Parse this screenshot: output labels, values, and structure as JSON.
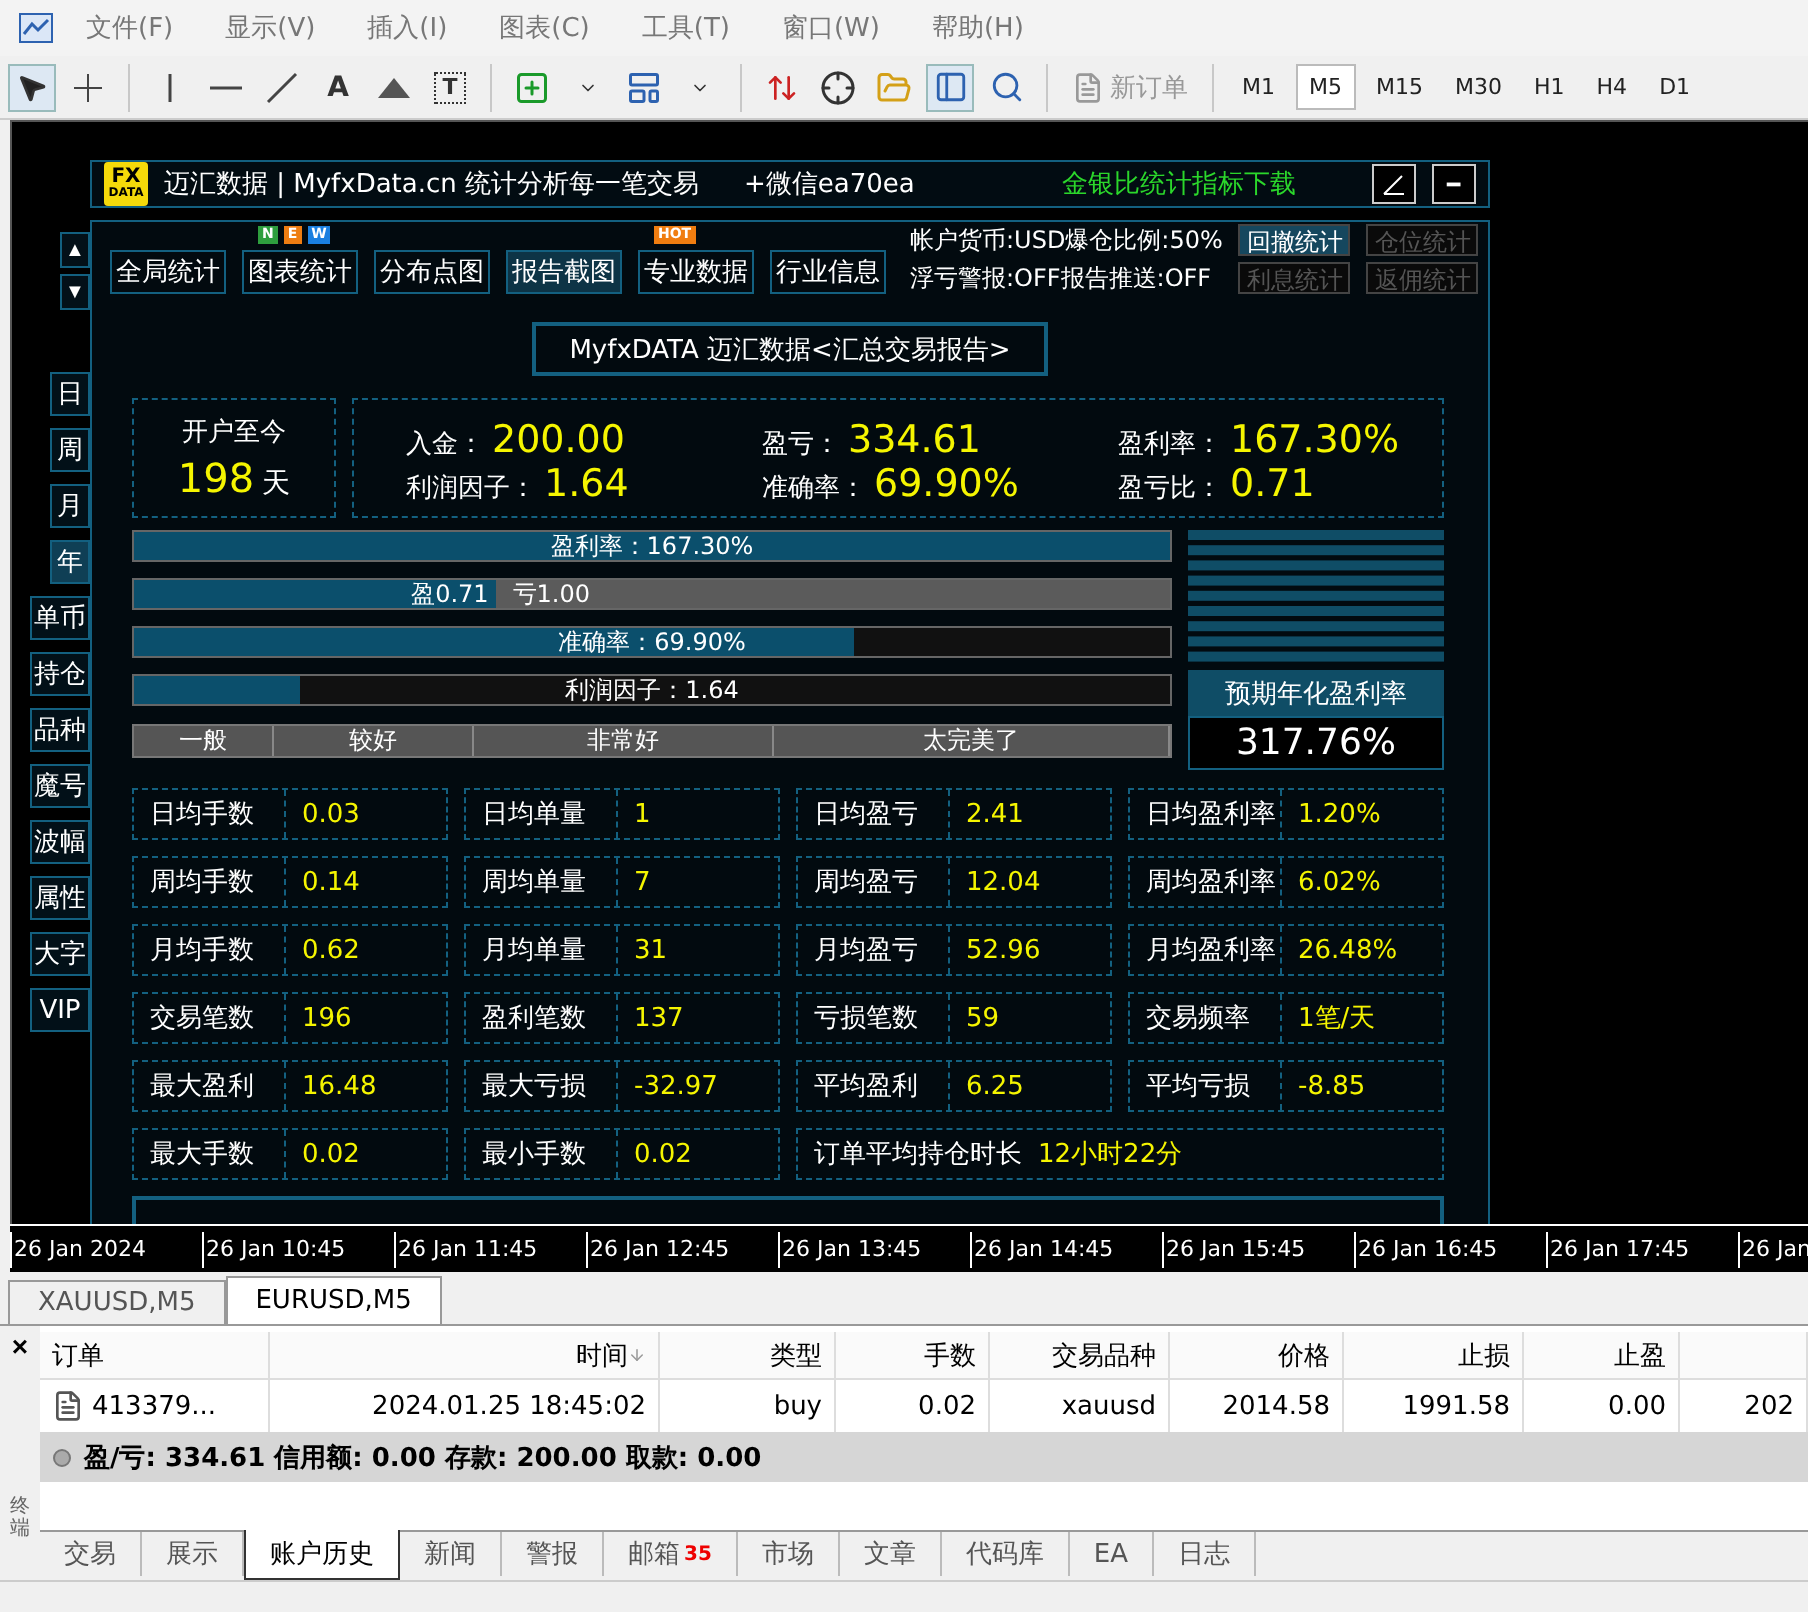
{
  "menu": [
    "文件(F)",
    "显示(V)",
    "插入(I)",
    "图表(C)",
    "工具(T)",
    "窗口(W)",
    "帮助(H)"
  ],
  "toolbar": {
    "text_tool": "A",
    "label_tool": "T",
    "new_order": {
      "label": "新订单",
      "disabled": true
    },
    "data_window_selected": true,
    "timeframes": [
      {
        "label": "M1",
        "selected": false
      },
      {
        "label": "M5",
        "selected": true
      },
      {
        "label": "M15",
        "selected": false
      },
      {
        "label": "M30",
        "selected": false
      },
      {
        "label": "H1",
        "selected": false
      },
      {
        "label": "H4",
        "selected": false
      },
      {
        "label": "D1",
        "selected": false
      }
    ]
  },
  "panel": {
    "logo_top": "FX",
    "logo_bottom": "DATA",
    "title": "迈汇数据 | MyfxData.cn  统计分析每一笔交易",
    "wechat": "+微信ea70ea",
    "download": "金银比统计指标下载",
    "minimize": "━",
    "scroll_up": "▲",
    "scroll_down": "▼",
    "periods": [
      {
        "label": "日",
        "selected": false
      },
      {
        "label": "周",
        "selected": false
      },
      {
        "label": "月",
        "selected": false
      },
      {
        "label": "年",
        "selected": true
      }
    ],
    "views": [
      "单币",
      "持仓",
      "品种",
      "魔号",
      "波幅",
      "属性",
      "大字",
      "VIP"
    ],
    "nav": [
      {
        "label": "全局统计",
        "selected": false
      },
      {
        "label": "图表统计",
        "selected": false,
        "badges": [
          {
            "text": "N",
            "color": "#2e9e3e"
          },
          {
            "text": "E",
            "color": "#ee7d12"
          },
          {
            "text": "W",
            "color": "#1a7fe0"
          }
        ]
      },
      {
        "label": "分布点图",
        "selected": false
      },
      {
        "label": "报告截图",
        "selected": true
      },
      {
        "label": "专业数据",
        "selected": false,
        "badges": [
          {
            "text": "HOT",
            "color": "#f07d10"
          }
        ]
      },
      {
        "label": "行业信息",
        "selected": false
      }
    ],
    "account_lines": [
      "帐户货币:USD爆仓比例:50%",
      "浮亏警报:OFF报告推送:OFF"
    ],
    "side_actions": [
      {
        "label": "回撤统计",
        "disabled": false
      },
      {
        "label": "仓位统计",
        "disabled": true
      },
      {
        "label": "利息统计",
        "disabled": true
      },
      {
        "label": "返佣统计",
        "disabled": true
      }
    ],
    "report_title": "MyfxDATA 迈汇数据<汇总交易报告>",
    "since": {
      "label": "开户至今",
      "value": "198",
      "unit": "天"
    },
    "metrics": [
      {
        "label": "入金：",
        "value": "200.00"
      },
      {
        "label": "盈亏：",
        "value": "334.61"
      },
      {
        "label": "盈利率：",
        "value": "167.30%"
      },
      {
        "label": "利润因子：",
        "value": "1.64"
      },
      {
        "label": "准确率：",
        "value": "69.90%"
      },
      {
        "label": "盈亏比：",
        "value": "0.71"
      }
    ],
    "bars": [
      {
        "kind": "single",
        "label": "盈利率：167.30%",
        "level": 1
      },
      {
        "kind": "split",
        "label": "盈0.71",
        "rest": "亏1.00",
        "level": 0.35
      },
      {
        "kind": "single",
        "label": "准确率：69.90%",
        "level": 0.695
      },
      {
        "kind": "single",
        "label": "利润因子：1.64",
        "level": 0.16
      }
    ],
    "rating": [
      "一般",
      "较好",
      "非常好",
      "太完美了"
    ],
    "annual": {
      "label": "预期年化盈利率",
      "value": "317.76%"
    },
    "stats": [
      [
        {
          "kind": "pair",
          "label": "日均手数",
          "value": "0.03"
        },
        {
          "kind": "pair",
          "label": "日均单量",
          "value": "1"
        },
        {
          "kind": "pair",
          "label": "日均盈亏",
          "value": "2.41"
        },
        {
          "kind": "pair",
          "label": "日均盈利率",
          "value": "1.20%"
        }
      ],
      [
        {
          "kind": "pair",
          "label": "周均手数",
          "value": "0.14"
        },
        {
          "kind": "pair",
          "label": "周均单量",
          "value": "7"
        },
        {
          "kind": "pair",
          "label": "周均盈亏",
          "value": "12.04"
        },
        {
          "kind": "pair",
          "label": "周均盈利率",
          "value": "6.02%"
        }
      ],
      [
        {
          "kind": "pair",
          "label": "月均手数",
          "value": "0.62"
        },
        {
          "kind": "pair",
          "label": "月均单量",
          "value": "31"
        },
        {
          "kind": "pair",
          "label": "月均盈亏",
          "value": "52.96"
        },
        {
          "kind": "pair",
          "label": "月均盈利率",
          "value": "26.48%"
        }
      ],
      [
        {
          "kind": "pair",
          "label": "交易笔数",
          "value": "196"
        },
        {
          "kind": "pair",
          "label": "盈利笔数",
          "value": "137"
        },
        {
          "kind": "pair",
          "label": "亏损笔数",
          "value": "59"
        },
        {
          "kind": "pair",
          "label": "交易频率",
          "value": "1笔/天"
        }
      ],
      [
        {
          "kind": "pair",
          "label": "最大盈利",
          "value": "16.48"
        },
        {
          "kind": "pair",
          "label": "最大亏损",
          "value": "-32.97"
        },
        {
          "kind": "pair",
          "label": "平均盈利",
          "value": "6.25"
        },
        {
          "kind": "pair",
          "label": "平均亏损",
          "value": "-8.85"
        }
      ],
      [
        {
          "kind": "pair",
          "label": "最大手数",
          "value": "0.02"
        },
        {
          "kind": "pair",
          "label": "最小手数",
          "value": "0.02"
        },
        {
          "kind": "wide",
          "label": "订单平均持仓时长",
          "value": "12小时22分"
        }
      ]
    ]
  },
  "time_axis": [
    "26 Jan 2024",
    "26 Jan 10:45",
    "26 Jan 11:45",
    "26 Jan 12:45",
    "26 Jan 13:45",
    "26 Jan 14:45",
    "26 Jan 15:45",
    "26 Jan 16:45",
    "26 Jan 17:45",
    "26 Jan"
  ],
  "chart_tabs": [
    {
      "label": "XAUUSD,M5",
      "selected": false
    },
    {
      "label": "EURUSD,M5",
      "selected": true
    }
  ],
  "terminal": {
    "close": "×",
    "side_label": "终端",
    "columns": [
      "订单",
      "时间",
      "类型",
      "手数",
      "交易品种",
      "价格",
      "止损",
      "止盈"
    ],
    "rows": [
      [
        "413379...",
        "2024.01.25 18:45:02",
        "buy",
        "0.02",
        "xauusd",
        "2014.58",
        "1991.58",
        "0.00",
        "202"
      ]
    ],
    "summary": "盈/亏: 334.61  信用额: 0.00  存款: 200.00  取款: 0.00",
    "tabs": [
      {
        "label": "交易",
        "selected": false
      },
      {
        "label": "展示",
        "selected": false
      },
      {
        "label": "账户历史",
        "selected": true
      },
      {
        "label": "新闻",
        "selected": false
      },
      {
        "label": "警报",
        "selected": false
      },
      {
        "label": "邮箱",
        "selected": false,
        "badge": "35"
      },
      {
        "label": "市场",
        "selected": false
      },
      {
        "label": "文章",
        "selected": false
      },
      {
        "label": "代码库",
        "selected": false
      },
      {
        "label": "EA",
        "selected": false
      },
      {
        "label": "日志",
        "selected": false
      }
    ]
  }
}
